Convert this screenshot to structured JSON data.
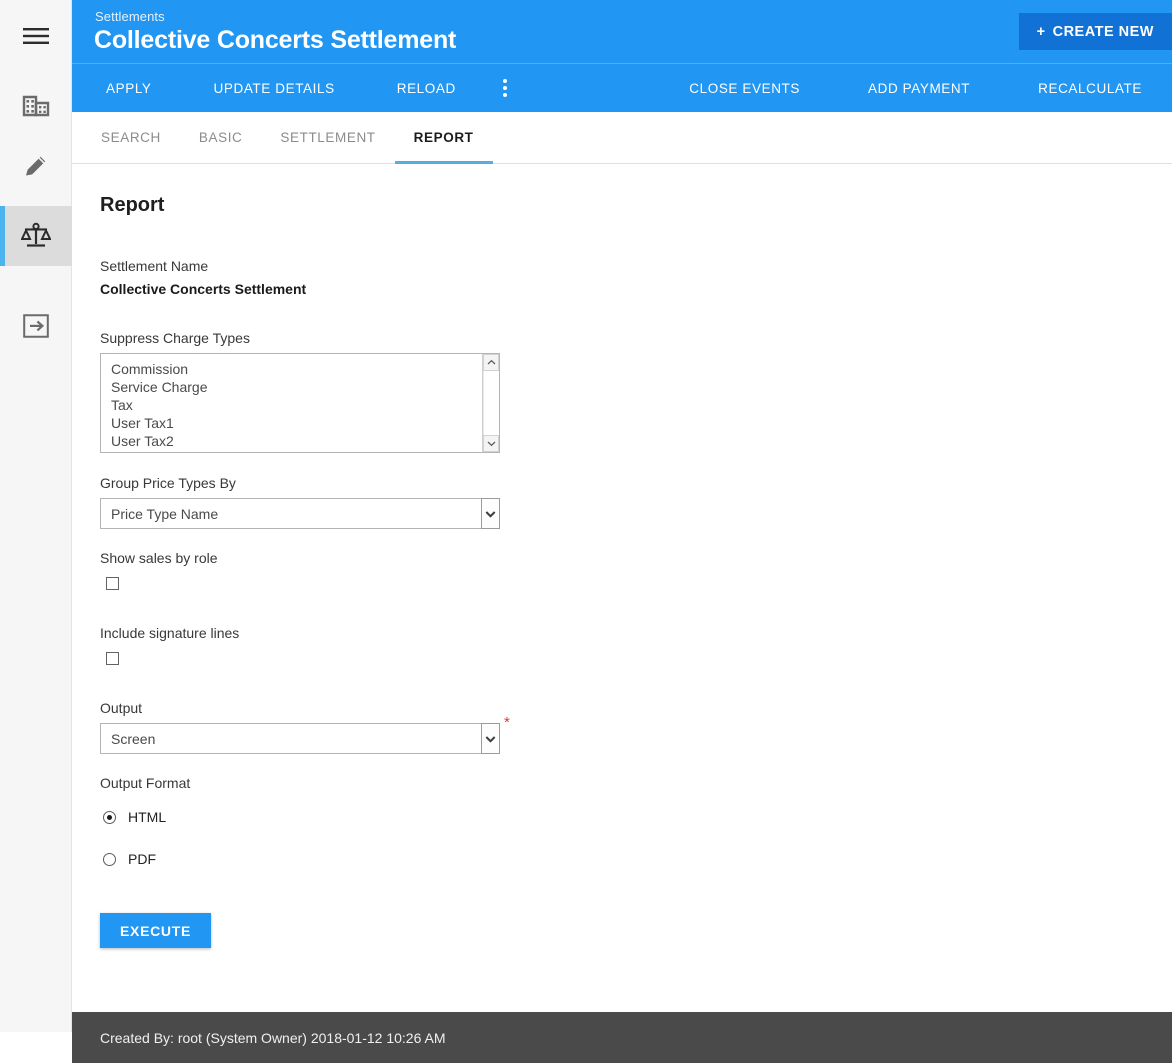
{
  "sidebar": {
    "items": [
      {
        "icon": "hamburger-menu-icon",
        "name": "menu-toggle",
        "active": false
      },
      {
        "icon": "building-icon",
        "name": "organizations",
        "active": false
      },
      {
        "icon": "pencil-icon",
        "name": "edit",
        "active": false
      },
      {
        "icon": "scales-icon",
        "name": "settlements",
        "active": true
      },
      {
        "icon": "logout-arrow-icon",
        "name": "logout",
        "active": false
      }
    ],
    "accent_color": "#4db3ef",
    "active_bg": "#dcdcdc"
  },
  "header": {
    "breadcrumb": "Settlements",
    "title": "Collective Concerts Settlement",
    "create_new_label": "CREATE NEW",
    "create_new_plus": "+",
    "background_color": "#2196f3",
    "create_new_color": "#1271d4"
  },
  "actionbar": {
    "left_actions": [
      "APPLY",
      "UPDATE DETAILS",
      "RELOAD"
    ],
    "overflow_icon": "kebab-menu-icon",
    "right_actions": [
      "CLOSE EVENTS",
      "ADD PAYMENT",
      "RECALCULATE"
    ]
  },
  "tabs": [
    {
      "label": "SEARCH",
      "active": false
    },
    {
      "label": "BASIC",
      "active": false
    },
    {
      "label": "SETTLEMENT",
      "active": false
    },
    {
      "label": "REPORT",
      "active": true
    }
  ],
  "form": {
    "heading": "Report",
    "settlement_name": {
      "label": "Settlement Name",
      "value": "Collective Concerts Settlement"
    },
    "suppress_charge_types": {
      "label": "Suppress Charge Types",
      "options": [
        "Commission",
        "Service Charge",
        "Tax",
        "User Tax1",
        "User Tax2"
      ],
      "scroll_up_icon": "chevron-up-icon",
      "scroll_down_icon": "chevron-down-icon"
    },
    "group_price_types_by": {
      "label": "Group Price Types By",
      "value": "Price Type Name",
      "dropdown_icon": "chevron-down-icon"
    },
    "show_sales_by_role": {
      "label": "Show sales by role",
      "checked": false
    },
    "include_signature_lines": {
      "label": "Include signature lines",
      "checked": false
    },
    "output": {
      "label": "Output",
      "value": "Screen",
      "required_marker": "*",
      "dropdown_icon": "chevron-down-icon"
    },
    "output_format": {
      "label": "Output Format",
      "options": [
        {
          "label": "HTML",
          "selected": true
        },
        {
          "label": "PDF",
          "selected": false
        }
      ]
    },
    "execute_label": "EXECUTE"
  },
  "footer": {
    "text": "Created By: root (System Owner) 2018-01-12 10:26 AM",
    "background_color": "#4a4a4a"
  }
}
